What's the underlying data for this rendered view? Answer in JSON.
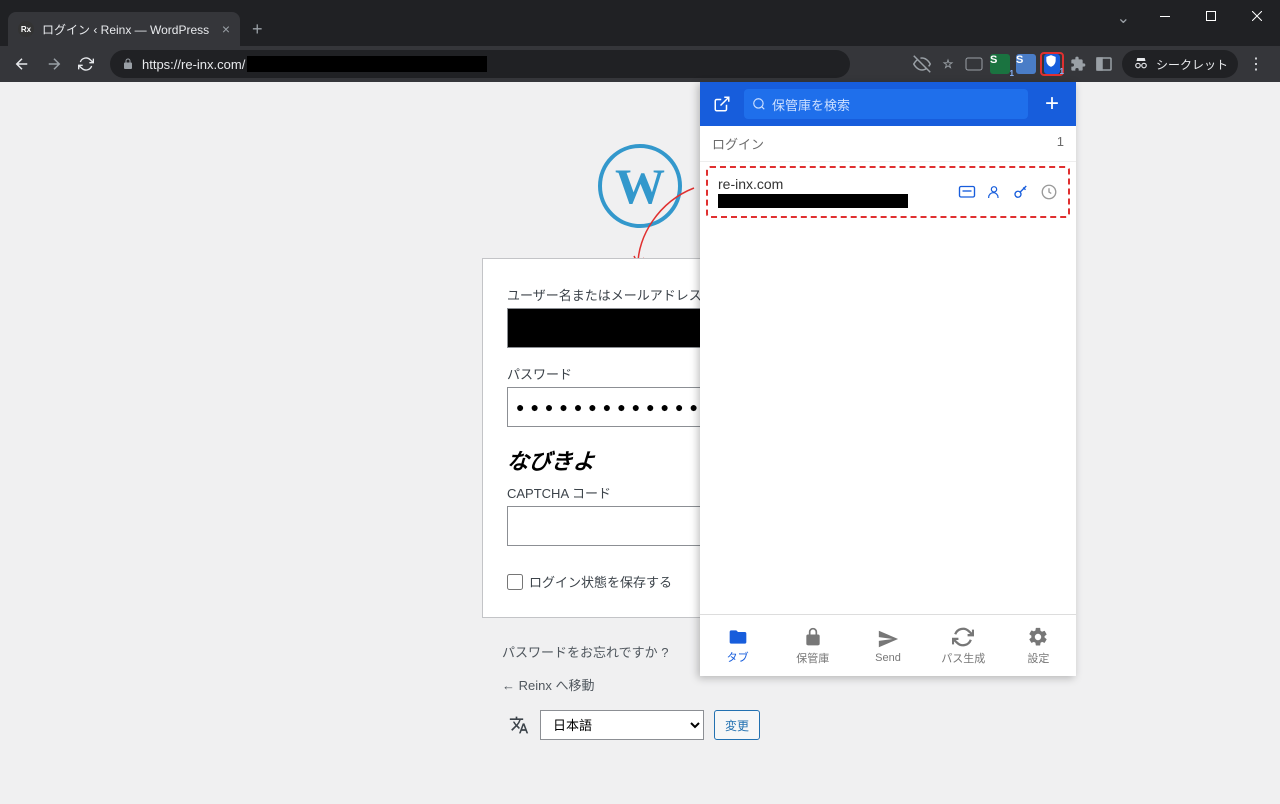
{
  "browser": {
    "tab_title": "ログイン ‹ Reinx — WordPress",
    "url_scheme": "https://",
    "url_host": "re-inx.com/",
    "incognito_label": "シークレット"
  },
  "wordpress": {
    "username_label": "ユーザー名またはメールアドレス",
    "password_label": "パスワード",
    "password_value": "●●●●●●●●●●●●●●",
    "captcha_text": "なびきよ",
    "captcha_label": "CAPTCHA コード",
    "remember_label": "ログイン状態を保存する",
    "forgot_link": "パスワードをお忘れですか ?",
    "back_link": "← Reinx へ移動",
    "lang_selected": "日本語",
    "lang_submit": "変更"
  },
  "bitwarden": {
    "search_placeholder": "保管庫を検索",
    "section_label": "ログイン",
    "section_count": "1",
    "item_title": "re-inx.com",
    "tabs": {
      "tab": "タブ",
      "vault": "保管庫",
      "send": "Send",
      "generator": "パス生成",
      "settings": "設定"
    }
  }
}
